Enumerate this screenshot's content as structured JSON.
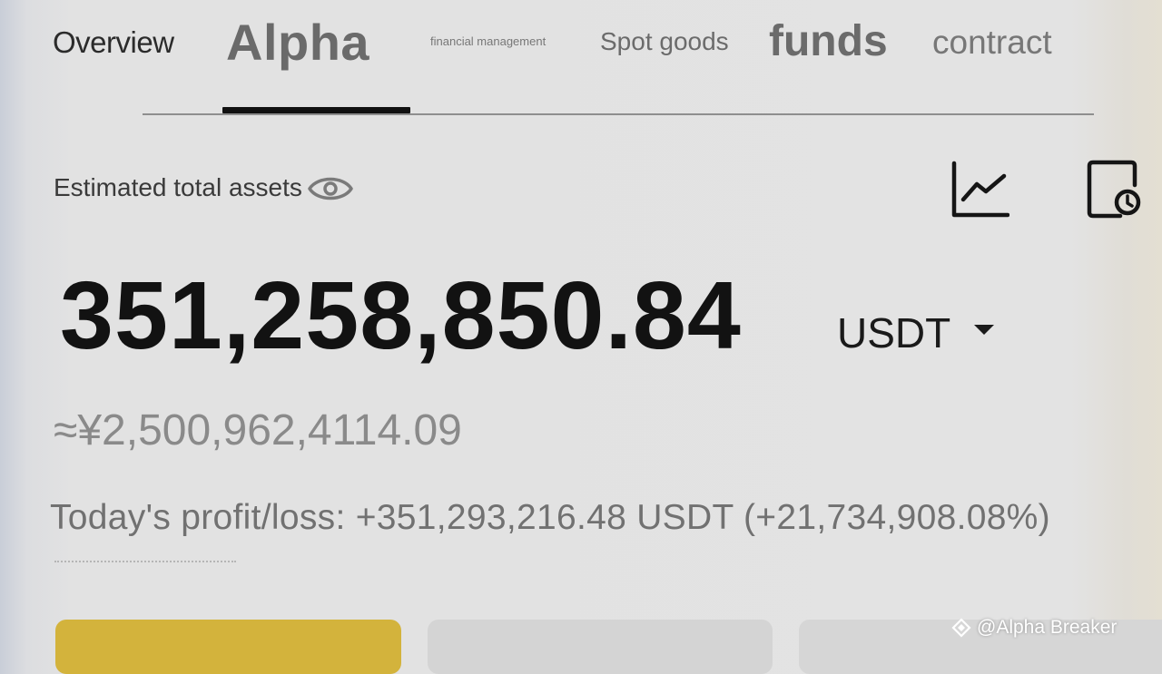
{
  "tabs": {
    "overview": "Overview",
    "alpha": "Alpha",
    "financial_management": "financial management",
    "spot_goods": "Spot goods",
    "funds": "funds",
    "contract": "contract",
    "active": "Alpha"
  },
  "assets": {
    "label": "Estimated total assets",
    "balance": "351,258,850.84",
    "currency": "USDT",
    "cny_equivalent": "≈¥2,500,962,4114.09",
    "pnl": "Today's profit/loss: +351,293,216.48 USDT (+21,734,908.08%)"
  },
  "icons": {
    "visibility": "eye-icon",
    "chart": "line-chart-icon",
    "history": "document-clock-icon",
    "dropdown": "caret-down-icon"
  },
  "colors": {
    "primary_button": "#d3b33c",
    "text_dark": "#121212",
    "text_muted": "#8a8a8a"
  },
  "watermark": {
    "text": "@Alpha Breaker"
  }
}
